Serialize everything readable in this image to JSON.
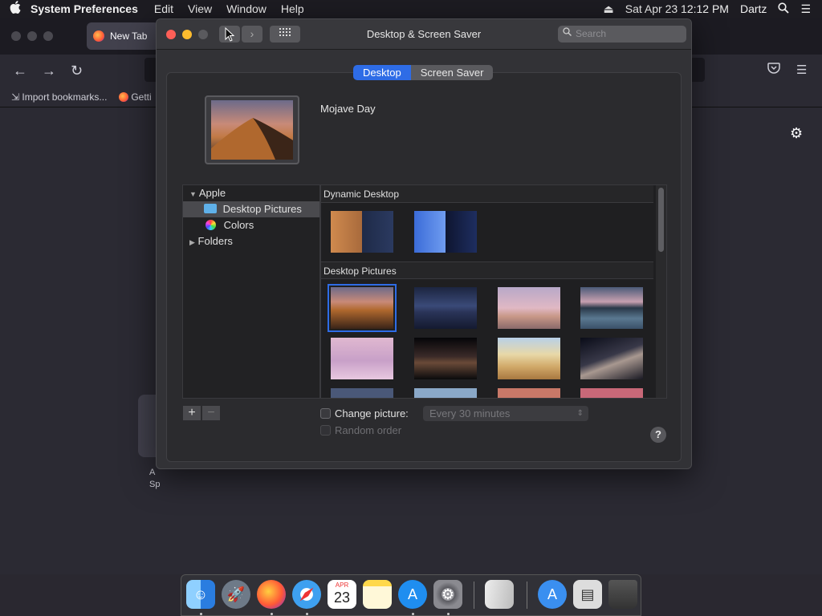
{
  "menubar": {
    "app_name": "System Preferences",
    "items": [
      "Edit",
      "View",
      "Window",
      "Help"
    ],
    "eject": "⏏",
    "datetime": "Sat Apr 23  12:12 PM",
    "user": "Dartz",
    "search_glyph": "⌕",
    "list_glyph": "☰"
  },
  "browser": {
    "tab_label": "New Tab",
    "bookmark_import": "Import bookmarks...",
    "bookmark_getting": "Getti",
    "shortcut_text": "A\nSp"
  },
  "window": {
    "title": "Desktop & Screen Saver",
    "search_placeholder": "Search",
    "back_glyph": "‹",
    "forward_glyph": "›",
    "grid_glyph": "⋮⋮⋮⋮",
    "tabs": [
      {
        "label": "Desktop",
        "active": true
      },
      {
        "label": "Screen Saver",
        "active": false
      }
    ],
    "picture_name": "Mojave Day",
    "sidebar": {
      "apple_label": "Apple",
      "desktop_pictures_label": "Desktop Pictures",
      "colors_label": "Colors",
      "folders_label": "Folders"
    },
    "gallery": {
      "dynamic_header": "Dynamic Desktop",
      "pictures_header": "Desktop Pictures"
    },
    "add_glyph": "+",
    "remove_glyph": "−",
    "change_picture_label": "Change picture:",
    "change_picture_checked": false,
    "interval_value": "Every 30 minutes",
    "random_order_label": "Random order",
    "help_glyph": "?"
  },
  "dock": {
    "items": [
      "Finder",
      "Launchpad",
      "Firefox",
      "Safari",
      "Calendar",
      "Notes",
      "App Store",
      "System Preferences",
      "TextEdit",
      "Applications",
      "Documents",
      "Trash"
    ],
    "calendar_month": "APR",
    "calendar_day": "23"
  },
  "colors": {
    "accent": "#2e6ce6",
    "close": "#fe5f57",
    "minimize": "#febc2e"
  }
}
